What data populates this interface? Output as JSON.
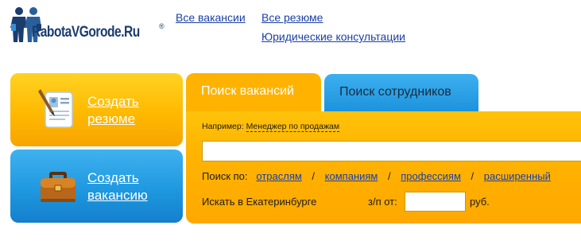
{
  "header": {
    "logo_text": "RabotaVGorode.Ru",
    "logo_reg": "®",
    "nav": [
      {
        "label": "Все вакансии"
      },
      {
        "label": "Все резюме"
      },
      {
        "label": "Юридические консультации"
      }
    ]
  },
  "actions": {
    "create_resume": "Создать резюме",
    "create_vacancy": "Создать вакансию"
  },
  "tabs": [
    {
      "label": "Поиск вакансий",
      "active": true
    },
    {
      "label": "Поиск сотрудников",
      "active": false
    }
  ],
  "search": {
    "example_prefix": "Например:",
    "example_value": "Менеджер по продажам",
    "query_value": "",
    "filter_prefix": "Поиск по:",
    "filters": [
      "отраслям",
      "компаниям",
      "профессиям",
      "расширенный"
    ],
    "separator": "/",
    "city_text": "Искать в Екатеринбурге",
    "salary_label": "з/п от:",
    "salary_value": "",
    "currency": "руб."
  },
  "colors": {
    "orange": "#ffb300",
    "blue": "#1d96de",
    "link": "#1a3fa7",
    "logo": "#1a3d6e"
  },
  "icons": {
    "resume": "resume-document-icon",
    "vacancy": "briefcase-icon",
    "logo": "people-figures-icon"
  }
}
